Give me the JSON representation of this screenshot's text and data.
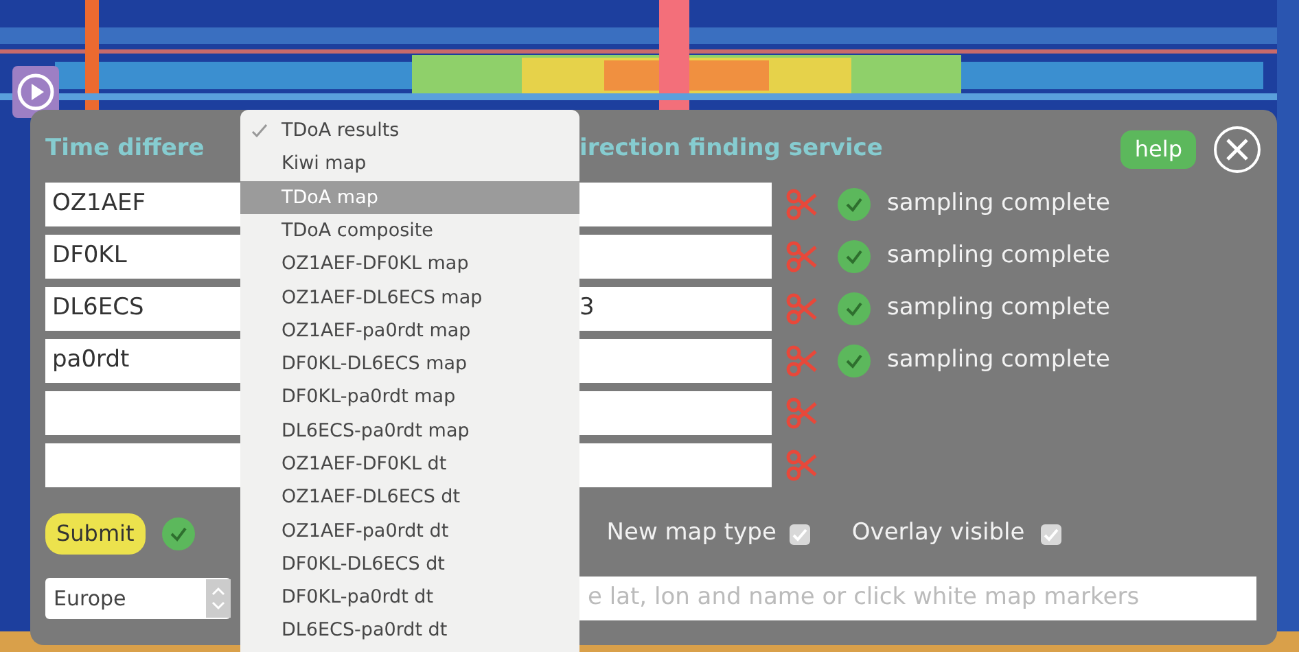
{
  "title": {
    "left": "Time differe",
    "right": "irection finding service"
  },
  "help_button": "help",
  "stations": [
    {
      "value": "OZ1AEF",
      "complete": true,
      "status": "sampling complete"
    },
    {
      "value": "DF0KL",
      "complete": true,
      "status": "sampling complete"
    },
    {
      "value": "DL6ECS",
      "tail": "3",
      "complete": true,
      "status": "sampling complete"
    },
    {
      "value": "pa0rdt",
      "complete": true,
      "status": "sampling complete"
    },
    {
      "complete": false
    },
    {
      "complete": false
    }
  ],
  "submit": {
    "label": "Submit",
    "ok": true
  },
  "options": [
    {
      "label": "New map type",
      "checked": true
    },
    {
      "label": "Overlay visible",
      "checked": true
    }
  ],
  "region_select": {
    "value": "Europe"
  },
  "location_field": {
    "placeholder": "e lat, lon and name or click white map markers"
  },
  "map_menu": {
    "items": [
      {
        "label": "TDoA results",
        "checked": true,
        "selected": false
      },
      {
        "label": "Kiwi map",
        "checked": false,
        "selected": false
      },
      {
        "label": "TDoA map",
        "checked": false,
        "selected": true
      },
      {
        "label": "TDoA composite",
        "checked": false,
        "selected": false
      },
      {
        "label": "OZ1AEF-DF0KL map",
        "checked": false,
        "selected": false
      },
      {
        "label": "OZ1AEF-DL6ECS map",
        "checked": false,
        "selected": false
      },
      {
        "label": "OZ1AEF-pa0rdt map",
        "checked": false,
        "selected": false
      },
      {
        "label": "DF0KL-DL6ECS map",
        "checked": false,
        "selected": false
      },
      {
        "label": "DF0KL-pa0rdt map",
        "checked": false,
        "selected": false
      },
      {
        "label": "DL6ECS-pa0rdt map",
        "checked": false,
        "selected": false
      },
      {
        "label": "OZ1AEF-DF0KL dt",
        "checked": false,
        "selected": false
      },
      {
        "label": "OZ1AEF-DL6ECS dt",
        "checked": false,
        "selected": false
      },
      {
        "label": "OZ1AEF-pa0rdt dt",
        "checked": false,
        "selected": false
      },
      {
        "label": "DF0KL-DL6ECS dt",
        "checked": false,
        "selected": false
      },
      {
        "label": "DF0KL-pa0rdt dt",
        "checked": false,
        "selected": false
      },
      {
        "label": "DL6ECS-pa0rdt dt",
        "checked": false,
        "selected": false
      }
    ]
  }
}
